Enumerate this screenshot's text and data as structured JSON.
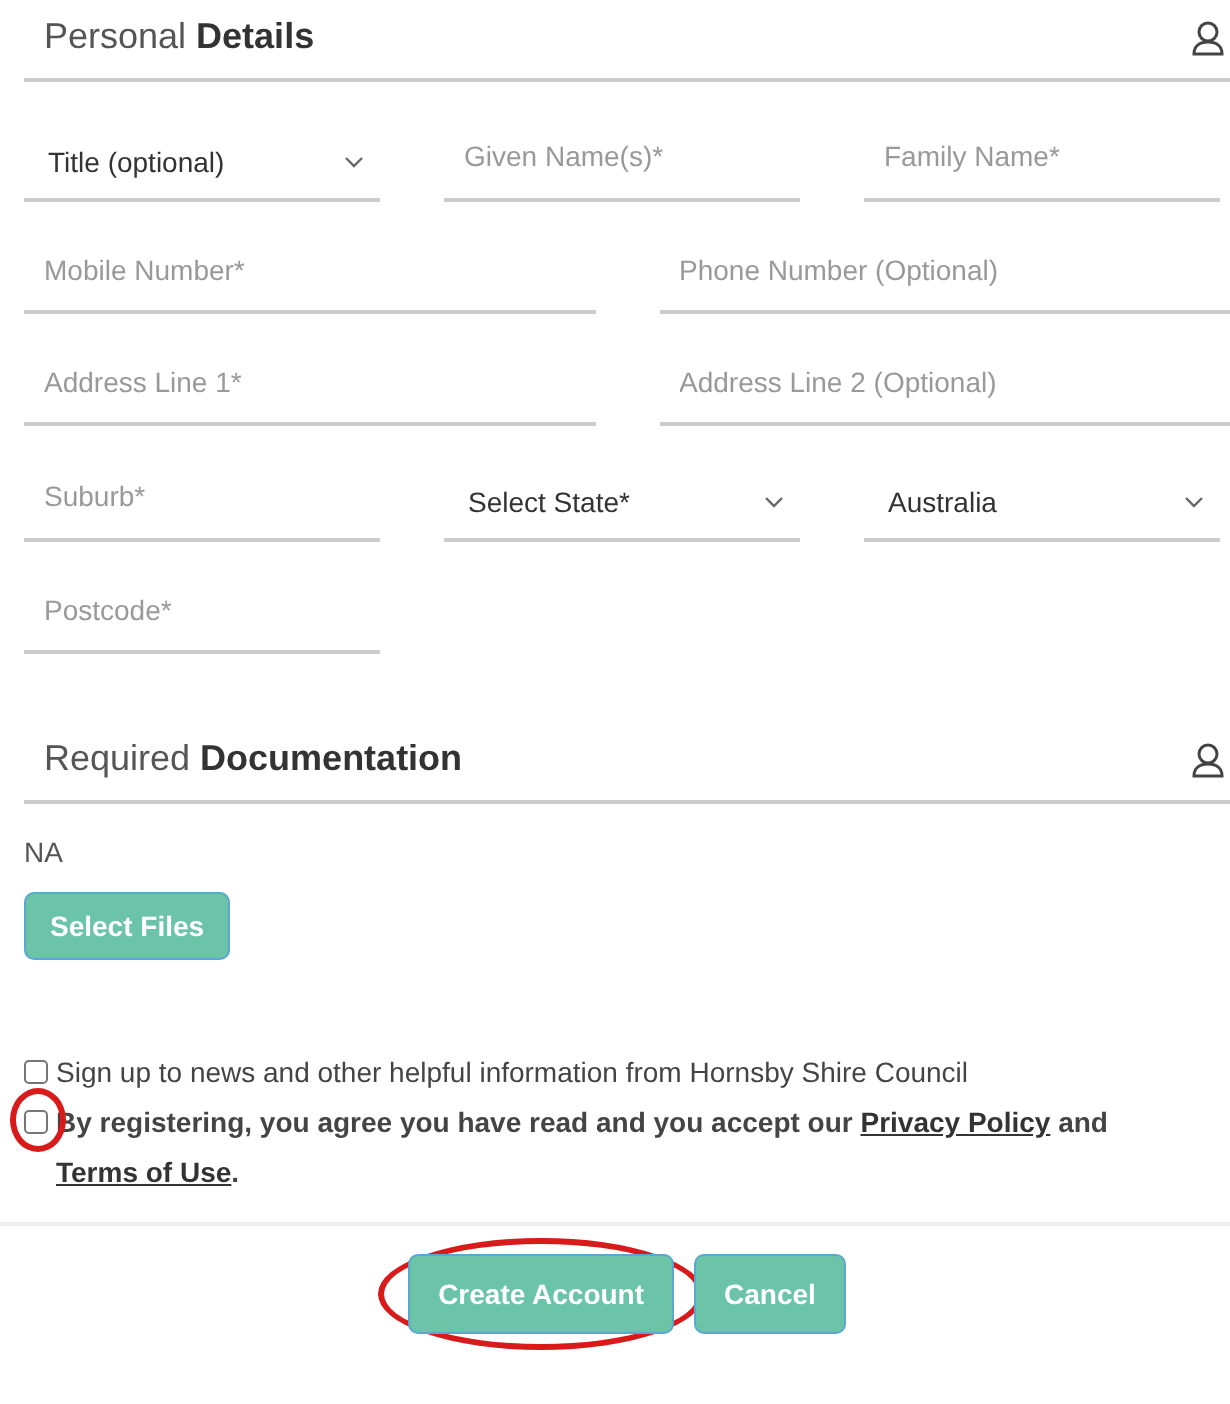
{
  "personal": {
    "title": "Personal **Details**",
    "rows": [
      [
        {
          "kind": "select",
          "text": "Title (optional)"
        },
        {
          "kind": "input",
          "placeholder": "Given Name(s)*"
        },
        {
          "kind": "input",
          "placeholder": "Family Name*"
        }
      ],
      [
        {
          "kind": "input",
          "placeholder": "Mobile Number*",
          "wide": true
        },
        {
          "kind": "input",
          "placeholder": "Phone Number (Optional)",
          "wide": true
        }
      ],
      [
        {
          "kind": "input",
          "placeholder": "Address Line 1*",
          "wide": true
        },
        {
          "kind": "input",
          "placeholder": "Address Line 2 (Optional)",
          "wide": true
        }
      ],
      [
        {
          "kind": "input",
          "placeholder": "Suburb*"
        },
        {
          "kind": "select",
          "text": "Select State*"
        },
        {
          "kind": "select",
          "text": "Australia"
        }
      ],
      [
        {
          "kind": "input",
          "placeholder": "Postcode*"
        }
      ]
    ]
  },
  "documentation": {
    "title": "Required **Documentation**",
    "note": "NA",
    "button": "Select Files"
  },
  "consents": [
    {
      "text": "Sign up to news and other helpful information from Hornsby Shire Council",
      "bold": false,
      "checked": false,
      "circled": false
    },
    {
      "text": "By registering, you agree you have read and you accept our ",
      "links": [
        "Privacy Policy",
        "Terms of Use"
      ],
      "joiner": " and ",
      "end": ".",
      "bold": true,
      "checked": false,
      "circled": true
    }
  ],
  "actions": [
    {
      "label": "Create Account",
      "circled": true
    },
    {
      "label": "Cancel",
      "circled": false
    }
  ]
}
